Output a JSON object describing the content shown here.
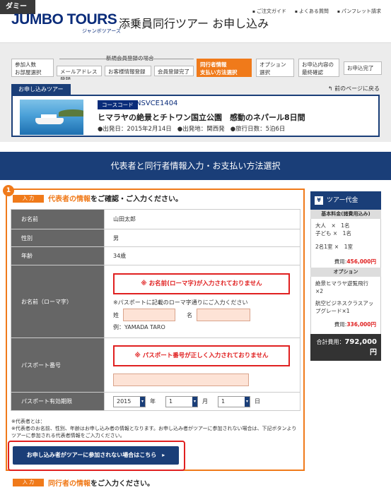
{
  "header": {
    "dummy_label": "ダミー",
    "logo": "JUMBO TOURS",
    "logo_sub": "ジャンボツアーズ",
    "title": "添乗員同行ツアー お申し込み",
    "util_links": [
      "ご注文ガイド",
      "よくある質問",
      "パンフレット請求"
    ]
  },
  "steps": {
    "group_label": "新規会員登録の場合",
    "items": [
      {
        "label": "参加人数\nお部屋選択"
      },
      {
        "label": "メールアドレス登録"
      },
      {
        "label": "お客様情報登録"
      },
      {
        "label": "会員登録完了"
      },
      {
        "label": "同行者情報\n支払い方法選択"
      },
      {
        "label": "オプション\n選択"
      },
      {
        "label": "お申込内容の\n最終確認"
      },
      {
        "label": "お申込完了"
      }
    ]
  },
  "tour": {
    "tab_label": "お申し込みツアー",
    "back_link": "前のページに戻る",
    "course_badge": "コースコード",
    "course_code": "NSVCE1404",
    "name": "ヒマラヤの絶景とチトワン国立公園　感動のネパール8日間",
    "departure_date": "●出発日：2015年2月14日",
    "departure_place": "●出発地：関西発",
    "duration": "●旅行日数：5泊6日"
  },
  "section_title": "代表者と同行者情報入力・お支払い方法選択",
  "rep_form": {
    "step_number": "1",
    "in_tag": "入 力",
    "heading_hl": "代表者の情報",
    "heading_rest": "をご確認・ご入力ください。",
    "rows": {
      "name_label": "お名前",
      "name_value": "山田太郎",
      "gender_label": "性別",
      "gender_value": "男",
      "age_label": "年齢",
      "age_value": "34歳",
      "roman_label": "お名前（ローマ字）",
      "roman_error": "※ お名前(ローマ字)が入力されておりません",
      "roman_note": "※パスポートに記載のローマ字通りにご入力ください",
      "surname_label": "姓",
      "given_label": "名",
      "roman_example": "例：YAMADA TARO",
      "passport_label": "パスポート番号",
      "passport_error": "※ パスポート番号が正しく入力されておりません",
      "expiry_label": "パスポート有効期限",
      "expiry_year": "2015",
      "year_unit": "年",
      "expiry_month": "1",
      "month_unit": "月",
      "expiry_day": "1",
      "day_unit": "日"
    },
    "footnote_title": "※代表者とは：",
    "footnote": "※代表者のお名前、性別、年齢はお申し込み者の情報となります。お申し込み者がツアーに参加されない場合は、下記ボタンよりツアーに参加される代表者情報をご入力ください。",
    "not_joining_button": "お申し込み者がツアーに参加されない場合はこちら　▸"
  },
  "companion": {
    "in_tag": "入 力",
    "heading_hl": "同行者の情報",
    "heading_rest": "をご入力ください。"
  },
  "sidebar": {
    "title": "ツアー代金",
    "yen_icon": "¥",
    "base_label": "基本料金(諸費用込み)",
    "adult": "大人　×　1名",
    "child": "子ども ×　1名",
    "room": "2名1室 ×　1室",
    "base_cost_label": "費用:",
    "base_cost": "456,000円",
    "option_label": "オプション",
    "option1": "絶景ヒマラヤ遊覧飛行×2",
    "option2": "航空ビジネスクラスアップグレード×1",
    "option_cost_label": "費用:",
    "option_cost": "336,000円",
    "total_label": "合計費用：",
    "total": "792,000円"
  },
  "colors": {
    "navy": "#1a3e78",
    "orange": "#f07a1a",
    "error_red": "#e02020"
  }
}
